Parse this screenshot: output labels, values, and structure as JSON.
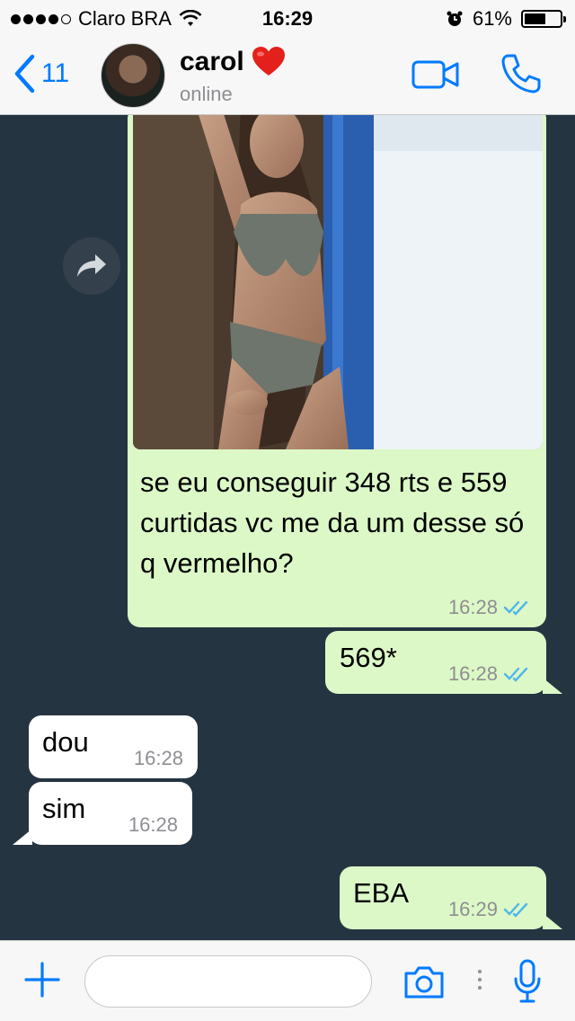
{
  "status_bar": {
    "carrier": "Claro BRA",
    "time": "16:29",
    "battery_percent": "61%",
    "battery_level": 0.61,
    "signal_icon": "signal-dots-icon",
    "wifi_icon": "wifi-icon",
    "alarm_icon": "alarm-icon"
  },
  "header": {
    "back_count": "11",
    "contact_name": "carol",
    "contact_emoji": "❤️",
    "contact_status": "online",
    "icons": [
      "back-chevron-icon",
      "video-call-icon",
      "phone-call-icon"
    ]
  },
  "messages": [
    {
      "direction": "out",
      "has_image": true,
      "text": "se eu conseguir 348 rts e 559 curtidas vc me da um desse só q vermelho?",
      "time": "16:28",
      "read": true
    },
    {
      "direction": "out",
      "text": "569*",
      "time": "16:28",
      "read": true
    },
    {
      "direction": "in",
      "text": "dou",
      "time": "16:28"
    },
    {
      "direction": "in",
      "text": "sim",
      "time": "16:28"
    },
    {
      "direction": "out",
      "text": "EBA",
      "time": "16:29",
      "read": true
    }
  ],
  "input_bar": {
    "placeholder": "",
    "icons": [
      "plus-icon",
      "camera-icon",
      "microphone-icon"
    ]
  },
  "colors": {
    "accent": "#007aff",
    "chat_background": "#253441",
    "outgoing_bubble": "#dcf8c6",
    "incoming_bubble": "#ffffff",
    "read_ticks": "#4fb6ec"
  }
}
